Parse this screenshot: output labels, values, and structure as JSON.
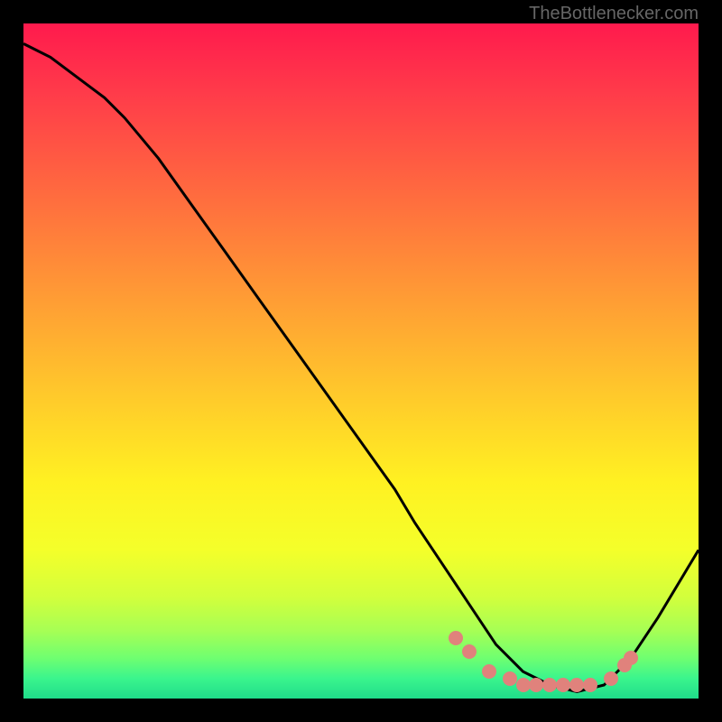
{
  "watermark": "TheBottlenecker.com",
  "chart_data": {
    "type": "line",
    "title": "",
    "xlabel": "",
    "ylabel": "",
    "xlim": [
      0,
      100
    ],
    "ylim": [
      0,
      100
    ],
    "series": [
      {
        "name": "curve",
        "x": [
          0,
          4,
          8,
          12,
          15,
          20,
          25,
          30,
          35,
          40,
          45,
          50,
          55,
          58,
          62,
          66,
          70,
          74,
          78,
          82,
          86,
          90,
          94,
          100
        ],
        "y": [
          97,
          95,
          92,
          89,
          86,
          80,
          73,
          66,
          59,
          52,
          45,
          38,
          31,
          26,
          20,
          14,
          8,
          4,
          2,
          1,
          2,
          6,
          12,
          22
        ]
      }
    ],
    "highlight_points": {
      "name": "highlight-dots",
      "x": [
        64,
        66,
        69,
        72,
        74,
        76,
        78,
        80,
        82,
        84,
        87,
        89,
        90
      ],
      "y": [
        9,
        7,
        4,
        3,
        2,
        2,
        2,
        2,
        2,
        2,
        3,
        5,
        6
      ]
    },
    "gradient_stops": [
      {
        "offset": 0.0,
        "color": "#ff1a4d"
      },
      {
        "offset": 0.1,
        "color": "#ff3a4a"
      },
      {
        "offset": 0.25,
        "color": "#ff6a3f"
      },
      {
        "offset": 0.4,
        "color": "#ff9a35"
      },
      {
        "offset": 0.55,
        "color": "#ffc92b"
      },
      {
        "offset": 0.68,
        "color": "#fff122"
      },
      {
        "offset": 0.78,
        "color": "#f4ff2a"
      },
      {
        "offset": 0.85,
        "color": "#d2ff3c"
      },
      {
        "offset": 0.9,
        "color": "#a6ff55"
      },
      {
        "offset": 0.94,
        "color": "#6fff70"
      },
      {
        "offset": 0.97,
        "color": "#3bf58d"
      },
      {
        "offset": 1.0,
        "color": "#1fdc8a"
      }
    ]
  }
}
